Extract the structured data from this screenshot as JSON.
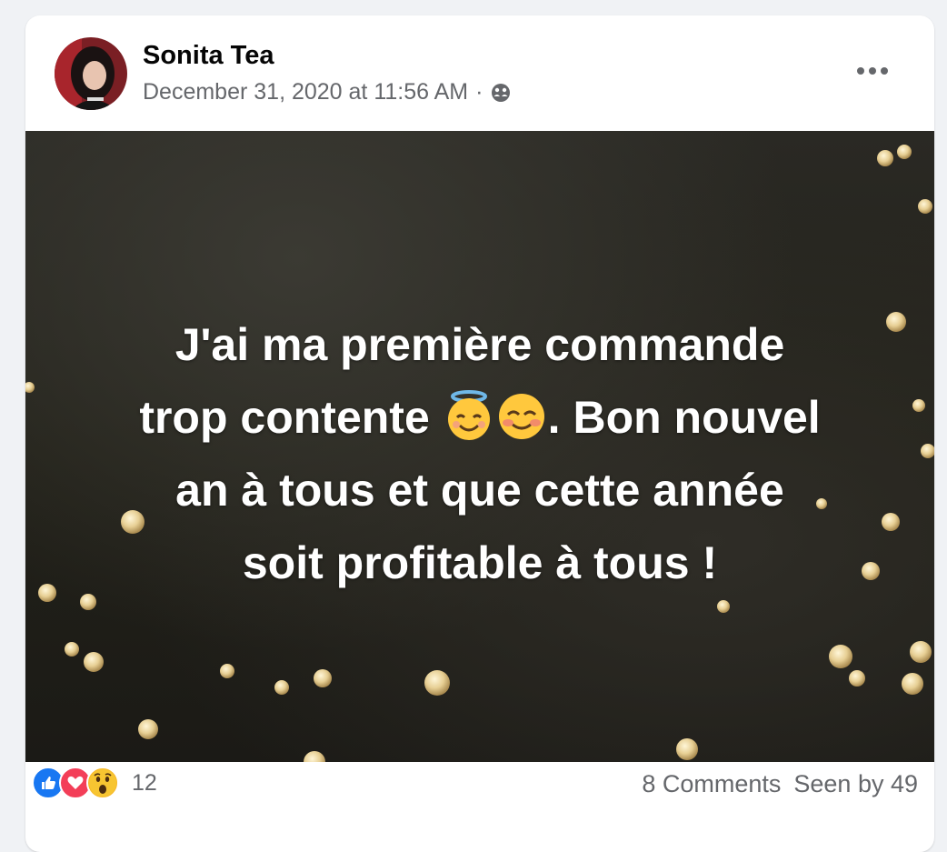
{
  "post": {
    "author": "Sonita Tea",
    "timestamp": "December 31, 2020 at 11:56 AM",
    "separator": "·",
    "audience_icon": "friends-globe-icon",
    "more_icon": "more-horizontal-icon",
    "text_lines": [
      "J'ai ma première commande",
      "trop contente",
      ". Bon nouvel",
      "an à tous et que cette année",
      "soit profitable à tous !"
    ],
    "emojis": [
      "smiling-face-with-halo",
      "smiling-face-blushing"
    ]
  },
  "footer": {
    "reaction_icons": [
      "like-icon",
      "love-icon",
      "wow-icon"
    ],
    "reaction_count": "12",
    "comments": "8 Comments",
    "seen_by": "Seen by 49"
  },
  "colors": {
    "like": "#1877f2",
    "love": "#f33e58",
    "wow": "#f7b928",
    "secondary_text": "#65676b"
  }
}
